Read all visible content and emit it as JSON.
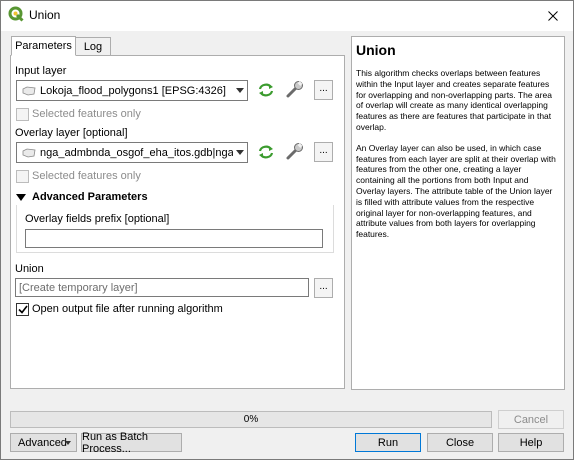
{
  "window": {
    "title": "Union"
  },
  "tabs": [
    {
      "label": "Parameters"
    },
    {
      "label": "Log"
    }
  ],
  "params": {
    "input_layer_label": "Input layer",
    "input_layer_value": "Lokoja_flood_polygons1 [EPSG:4326]",
    "selected_only_1": "Selected features only",
    "overlay_layer_label": "Overlay layer [optional]",
    "overlay_layer_value": "nga_admbnda_osgof_eha_itos.gdb|nga_admbnd",
    "selected_only_2": "Selected features only",
    "advanced_header": "Advanced Parameters",
    "overlay_prefix_label": "Overlay fields prefix [optional]",
    "overlay_prefix_value": "",
    "union_label": "Union",
    "union_placeholder": "[Create temporary layer]",
    "open_output_label": "Open output file after running algorithm",
    "dots": "..."
  },
  "help": {
    "title": "Union",
    "p1": "This algorithm checks overlaps between features within the Input layer and creates separate features for overlapping and non-overlapping parts. The area of overlap will create as many identical overlapping features as there are features that participate in that overlap.",
    "p2": "An Overlay layer can also be used, in which case features from each layer are split at their overlap with features from the other one, creating a layer containing all the portions from both Input and Overlay layers. The attribute table of the Union layer is filled with attribute values from the respective original layer for non-overlapping features, and attribute values from both layers for overlapping features."
  },
  "progress": {
    "percent": 0,
    "text": "0%"
  },
  "buttons": {
    "cancel": "Cancel",
    "advanced": "Advanced",
    "batch": "Run as Batch Process...",
    "run": "Run",
    "close": "Close",
    "help": "Help"
  },
  "colors": {
    "accent": "#0078d7",
    "qgis_green": "#589632",
    "qgis_yellow": "#f0c330"
  }
}
